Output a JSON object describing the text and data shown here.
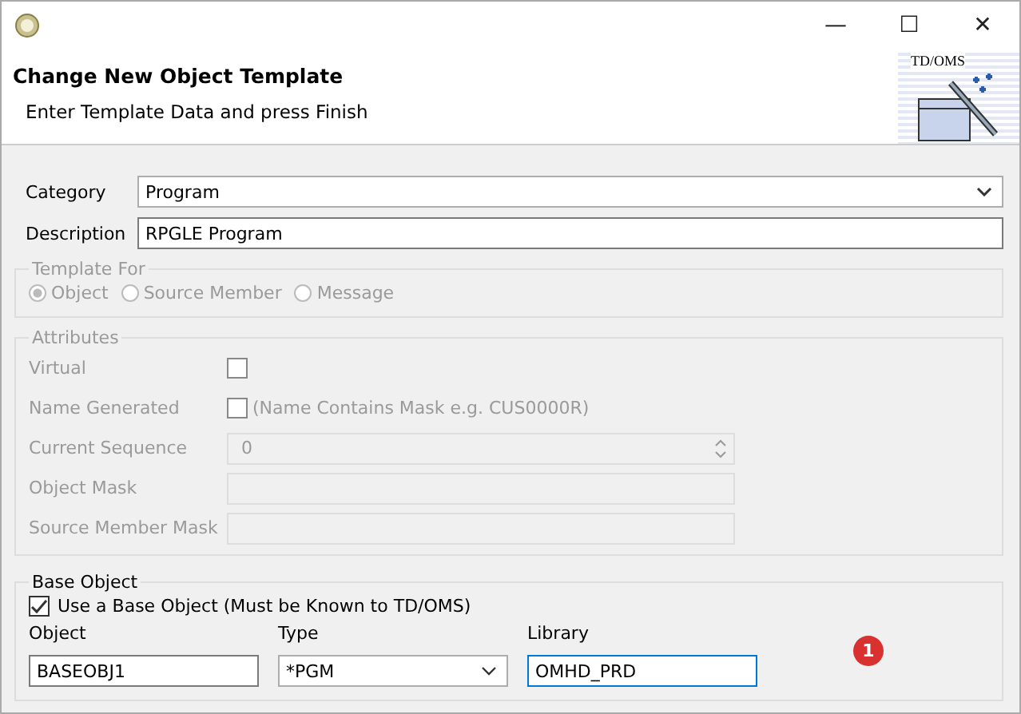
{
  "window": {
    "controls": {
      "minimize": "—",
      "maximize": "☐",
      "close": "✕"
    }
  },
  "header": {
    "title": "Change New Object Template",
    "subtitle": "Enter Template Data and press Finish",
    "logo_text": "TD/OMS"
  },
  "category": {
    "label": "Category",
    "value": "Program"
  },
  "description": {
    "label": "Description",
    "value": "RPGLE Program"
  },
  "template_for": {
    "title": "Template For",
    "disabled": true,
    "options": [
      {
        "label": "Object",
        "selected": true
      },
      {
        "label": "Source Member",
        "selected": false
      },
      {
        "label": "Message",
        "selected": false
      }
    ]
  },
  "attributes": {
    "title": "Attributes",
    "disabled": true,
    "rows": [
      {
        "kind": "checkbox",
        "label": "Virtual",
        "checked": false
      },
      {
        "kind": "checkbox",
        "label": "Name Generated",
        "checked": false,
        "note": "(Name Contains Mask e.g. CUS0000R)"
      },
      {
        "kind": "spinner",
        "label": "Current Sequence",
        "value": "0"
      },
      {
        "kind": "text",
        "label": "Object Mask"
      },
      {
        "kind": "text",
        "label": "Source Member Mask"
      }
    ]
  },
  "base_object": {
    "title": "Base Object",
    "use": {
      "label": "Use a Base Object (Must be Known to TD/OMS)",
      "checked": true
    },
    "fields": [
      {
        "kind": "text",
        "label": "Object",
        "value": "BASEOBJ1",
        "focused": false
      },
      {
        "kind": "combo",
        "label": "Type",
        "value": "*PGM",
        "focused": false
      },
      {
        "kind": "text",
        "label": "Library",
        "value": "OMHD_PRD",
        "focused": true
      }
    ]
  },
  "badge": "1"
}
